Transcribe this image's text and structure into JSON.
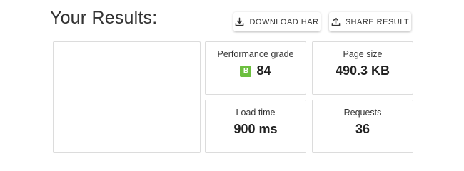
{
  "header": {
    "title": "Your Results:"
  },
  "actions": {
    "download_label": "DOWNLOAD HAR",
    "download_icon": "download-icon",
    "share_label": "SHARE RESULT",
    "share_icon": "upload-icon"
  },
  "metrics": {
    "performance": {
      "label": "Performance grade",
      "grade": "B",
      "value": "84",
      "grade_color": "#6cbf3f"
    },
    "page_size": {
      "label": "Page size",
      "value": "490.3 KB"
    },
    "load_time": {
      "label": "Load time",
      "value": "900 ms"
    },
    "requests": {
      "label": "Requests",
      "value": "36"
    }
  }
}
